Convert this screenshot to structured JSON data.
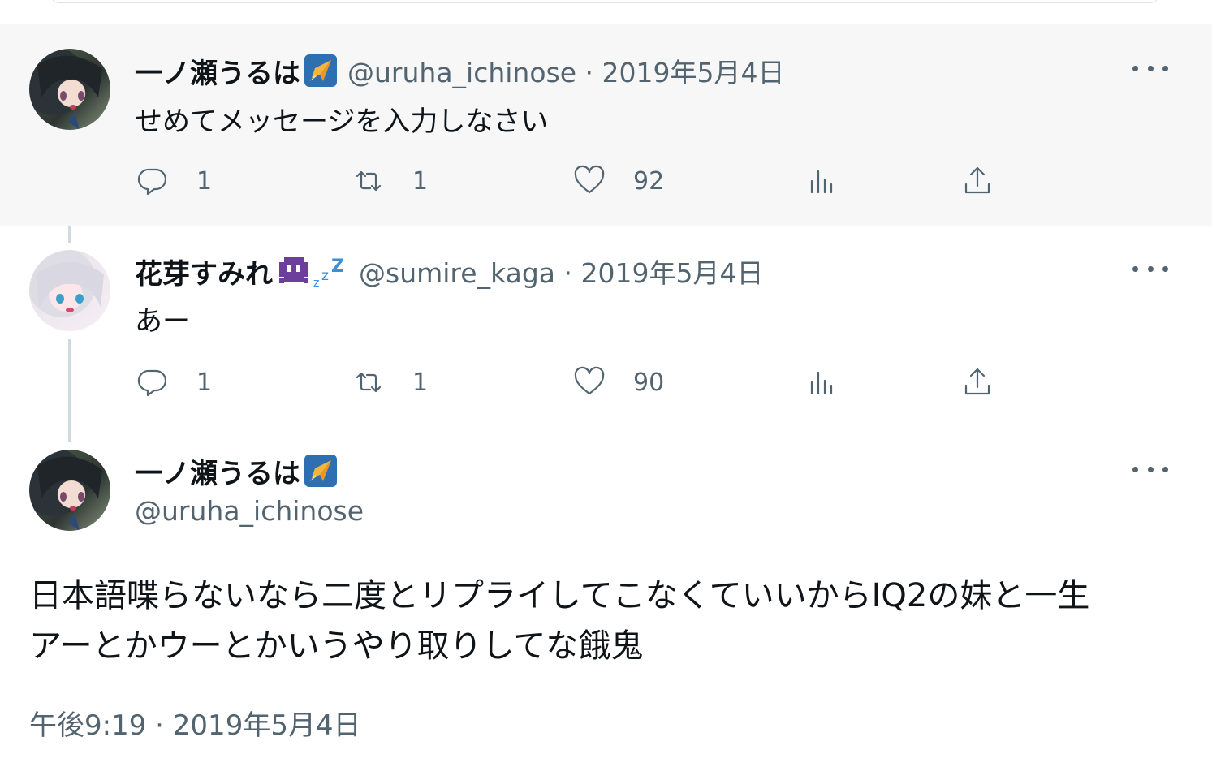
{
  "replies": [
    {
      "name": "一ノ瀬うるは",
      "badge_icon": "rocket-emoji",
      "handle": "@uruha_ichinose",
      "date": "2019年5月4日",
      "text": "せめてメッセージを入力しなさい",
      "counts": {
        "replies": "1",
        "retweets": "1",
        "likes": "92"
      }
    },
    {
      "name": "花芽すみれ",
      "badge_icon": "space-invader-zzz-emoji",
      "handle": "@sumire_kaga",
      "date": "2019年5月4日",
      "text": "あー",
      "counts": {
        "replies": "1",
        "retweets": "1",
        "likes": "90"
      }
    }
  ],
  "main_tweet": {
    "name": "一ノ瀬うるは",
    "badge_icon": "rocket-emoji",
    "handle": "@uruha_ichinose",
    "text_line1": "日本語喋らないなら二度とリプライしてこなくていいからIQ2の妹と一生",
    "text_line2": "アーとかウーとかいうやり取りしてな餓鬼",
    "time": "午後9:19",
    "date": "2019年5月4日"
  },
  "separator": "·",
  "colors": {
    "text": "#0f1419",
    "secondary": "#536471",
    "highlight_bg": "#f7f7f7",
    "thread_line": "#cfd9de"
  }
}
